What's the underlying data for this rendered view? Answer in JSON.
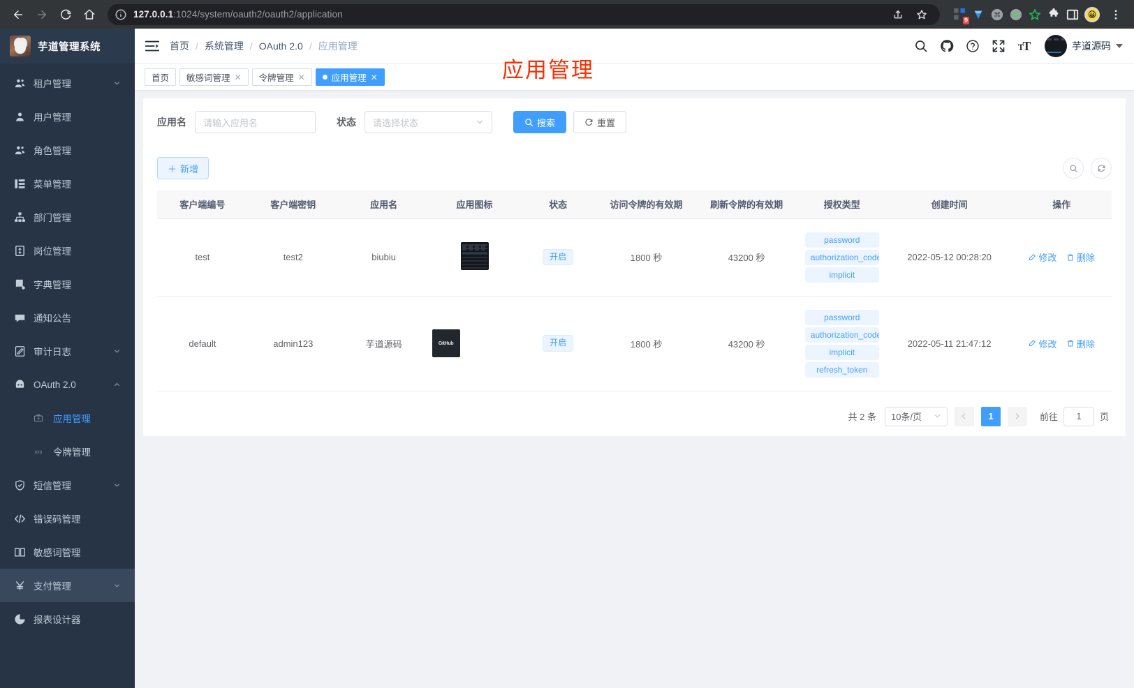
{
  "browser": {
    "url_host": "127.0.0.1",
    "url_rest": ":1024/system/oauth2/oauth2/application",
    "back_icon": "back-arrow-icon",
    "forward_icon": "forward-arrow-icon",
    "reload_icon": "reload-icon",
    "home_icon": "home-icon",
    "info_icon": "site-info-icon",
    "share_icon": "share-icon",
    "bookmark_icon": "star-icon",
    "menu_icon": "kebab-menu-icon",
    "extension_badge": "9"
  },
  "sidebar": {
    "logo_title": "芋道管理系统",
    "items": [
      {
        "label": "租户管理",
        "icon": "users-icon",
        "expandable": true,
        "level": 0
      },
      {
        "label": "用户管理",
        "icon": "user-icon",
        "expandable": false,
        "level": 0
      },
      {
        "label": "角色管理",
        "icon": "role-icon",
        "expandable": false,
        "level": 0
      },
      {
        "label": "菜单管理",
        "icon": "menu-list-icon",
        "expandable": false,
        "level": 0
      },
      {
        "label": "部门管理",
        "icon": "org-tree-icon",
        "expandable": false,
        "level": 0
      },
      {
        "label": "岗位管理",
        "icon": "badge-icon",
        "expandable": false,
        "level": 0
      },
      {
        "label": "字典管理",
        "icon": "dictionary-icon",
        "expandable": false,
        "level": 0
      },
      {
        "label": "通知公告",
        "icon": "announcement-icon",
        "expandable": false,
        "level": 0
      },
      {
        "label": "审计日志",
        "icon": "edit-log-icon",
        "expandable": true,
        "level": 0
      },
      {
        "label": "OAuth 2.0",
        "icon": "robot-icon",
        "expandable": true,
        "expanded": true,
        "level": 0
      },
      {
        "label": "应用管理",
        "icon": "briefcase-icon",
        "expandable": false,
        "level": 1,
        "active": true
      },
      {
        "label": "令牌管理",
        "icon": "token-icon",
        "expandable": false,
        "level": 1
      },
      {
        "label": "短信管理",
        "icon": "shield-icon",
        "expandable": true,
        "level": 0
      },
      {
        "label": "错误码管理",
        "icon": "code-icon",
        "expandable": false,
        "level": 0
      },
      {
        "label": "敏感词管理",
        "icon": "book-icon",
        "expandable": false,
        "level": 0
      },
      {
        "label": "支付管理",
        "icon": "yuan-icon",
        "expandable": true,
        "level": 0,
        "hovered": true
      },
      {
        "label": "报表设计器",
        "icon": "report-icon",
        "expandable": false,
        "level": 0
      }
    ]
  },
  "topbar": {
    "hamburger_icon": "collapse-menu-icon",
    "breadcrumb": [
      "首页",
      "系统管理",
      "OAuth 2.0",
      "应用管理"
    ],
    "icons": [
      "search-icon",
      "github-icon",
      "help-icon",
      "fullscreen-icon",
      "font-size-icon"
    ],
    "user_name": "芋道源码"
  },
  "tabs": [
    {
      "label": "首页",
      "closable": false,
      "active": false
    },
    {
      "label": "敏感词管理",
      "closable": true,
      "active": false
    },
    {
      "label": "令牌管理",
      "closable": true,
      "active": false
    },
    {
      "label": "应用管理",
      "closable": true,
      "active": true
    }
  ],
  "overlay_title": "应用管理",
  "filter": {
    "app_name_label": "应用名",
    "app_name_value": "",
    "app_name_placeholder": "请输入应用名",
    "status_label": "状态",
    "status_value": "",
    "status_placeholder": "请选择状态",
    "search_button": "搜索",
    "search_icon": "search-icon",
    "reset_button": "重置",
    "reset_icon": "refresh-icon"
  },
  "toolbar": {
    "add_button": "新增",
    "add_icon": "plus-icon",
    "search_round_icon": "search-icon",
    "refresh_round_icon": "refresh-icon"
  },
  "table": {
    "columns": [
      "客户端编号",
      "客户端密钥",
      "应用名",
      "应用图标",
      "状态",
      "访问令牌的有效期",
      "刷新令牌的有效期",
      "授权类型",
      "创建时间",
      "操作"
    ],
    "rows": [
      {
        "client_id": "test",
        "client_secret": "test2",
        "app_name": "biubiu",
        "app_icon": "screenshot-thumbnail",
        "status": "开启",
        "access_token_validity": "1800 秒",
        "refresh_token_validity": "43200 秒",
        "grant_types": [
          "password",
          "authorization_code",
          "implicit"
        ],
        "create_time": "2022-05-12 00:28:20",
        "edit_label": "修改",
        "delete_label": "删除"
      },
      {
        "client_id": "default",
        "client_secret": "admin123",
        "app_name": "芋道源码",
        "app_icon": "github-thumbnail",
        "status": "开启",
        "access_token_validity": "1800 秒",
        "refresh_token_validity": "43200 秒",
        "grant_types": [
          "password",
          "authorization_code",
          "implicit",
          "refresh_token"
        ],
        "create_time": "2022-05-11 21:47:12",
        "edit_label": "修改",
        "delete_label": "删除"
      }
    ]
  },
  "pagination": {
    "total_text": "共 2 条",
    "page_size": "10条/页",
    "prev_icon": "chevron-left-icon",
    "current_page": "1",
    "next_icon": "chevron-right-icon",
    "jump_prefix": "前往",
    "jump_value": "1",
    "jump_suffix": "页"
  },
  "colors": {
    "primary": "#409eff",
    "sidebar_bg": "#263445",
    "overlay_title": "#fa2e00"
  }
}
